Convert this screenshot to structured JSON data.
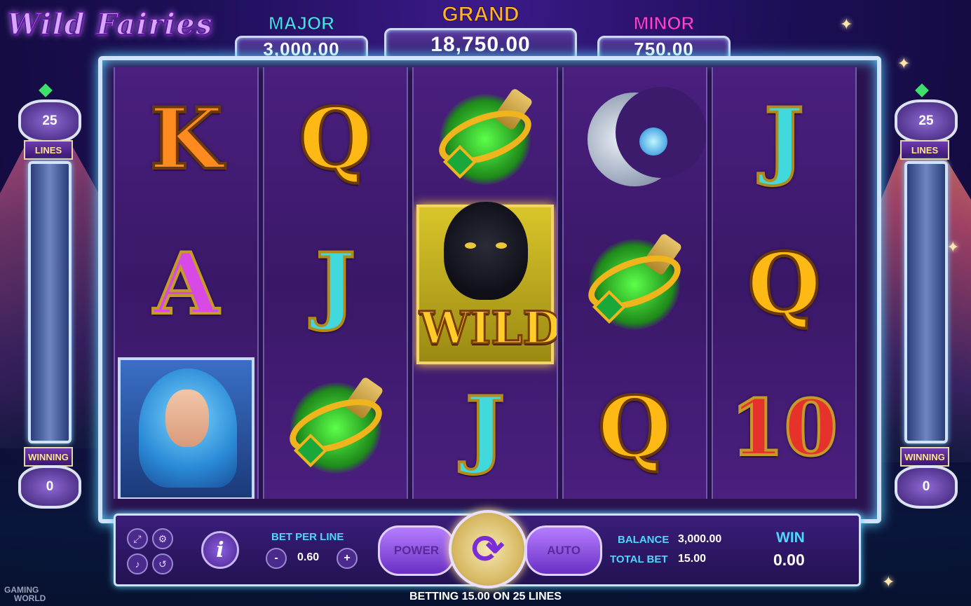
{
  "game": {
    "title": "Wild Fairies"
  },
  "jackpots": {
    "major": {
      "label": "MAJOR",
      "value": "3,000.00",
      "color": "#3fe1e9"
    },
    "grand": {
      "label": "GRAND",
      "value": "18,750.00",
      "color": "#ffb51f"
    },
    "minor": {
      "label": "MINOR",
      "value": "750.00",
      "color": "#ff3fd6"
    }
  },
  "reels": [
    {
      "symbols": [
        "K",
        "A",
        "fairy-portrait"
      ]
    },
    {
      "symbols": [
        "Q",
        "J",
        "potion"
      ]
    },
    {
      "symbols": [
        "potion",
        "WILD",
        "J"
      ]
    },
    {
      "symbols": [
        "moon-pendant",
        "potion",
        "Q"
      ]
    },
    {
      "symbols": [
        "J",
        "Q",
        "10"
      ]
    }
  ],
  "wild_label": "WILD",
  "left_meter": {
    "lines_value": "25",
    "lines_label": "LINES",
    "winning_label": "WINNING",
    "winning_value": "0"
  },
  "right_meter": {
    "lines_value": "25",
    "lines_label": "LINES",
    "winning_label": "WINNING",
    "winning_value": "0"
  },
  "console": {
    "bet_per_line_label": "BET PER LINE",
    "bet_per_line_value": "0.60",
    "minus_label": "-",
    "plus_label": "+",
    "info_label": "i",
    "power_label": "POWER",
    "auto_label": "AUTO",
    "balance_label": "BALANCE",
    "balance_value": "3,000.00",
    "total_bet_label": "TOTAL BET",
    "total_bet_value": "15.00",
    "win_label": "WIN",
    "win_value": "0.00"
  },
  "status_text": "BETTING 15.00 ON 25 LINES",
  "branding": {
    "line1": "GAMING",
    "line2": "WORLD"
  }
}
